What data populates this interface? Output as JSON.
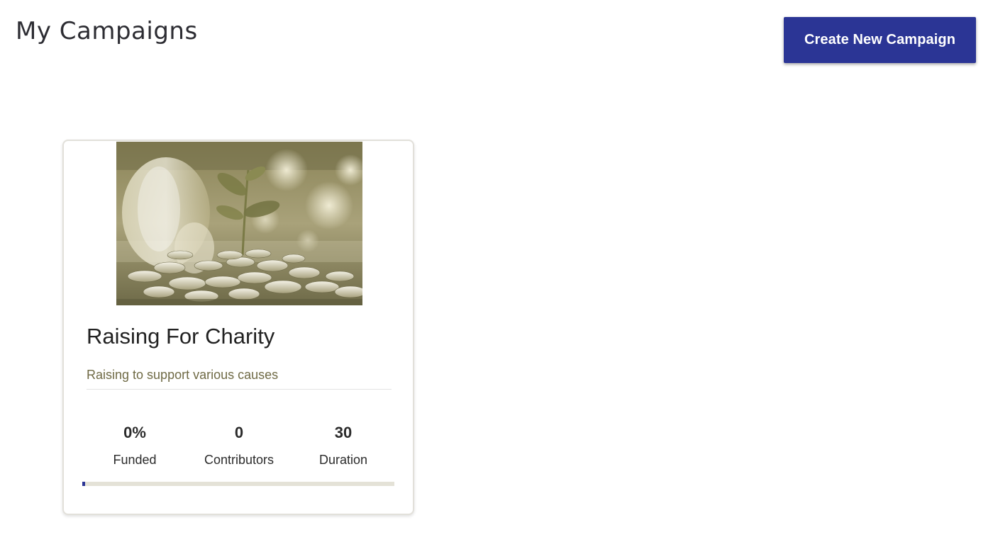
{
  "header": {
    "title": "My Campaigns",
    "create_button_label": "Create New Campaign"
  },
  "campaigns": [
    {
      "title": "Raising For Charity",
      "description": "Raising to support various causes",
      "image_icon": "coins-plant-jar-photo",
      "stats": {
        "funded": "0%",
        "funded_label": "Funded",
        "contributors": "0",
        "contributors_label": "Contributors",
        "duration": "30",
        "duration_label": "Duration"
      },
      "progress_fraction": 0
    }
  ],
  "colors": {
    "accent": "#2b3595",
    "progress_track": "#e4e2d7",
    "description_text": "#6f6a45"
  }
}
